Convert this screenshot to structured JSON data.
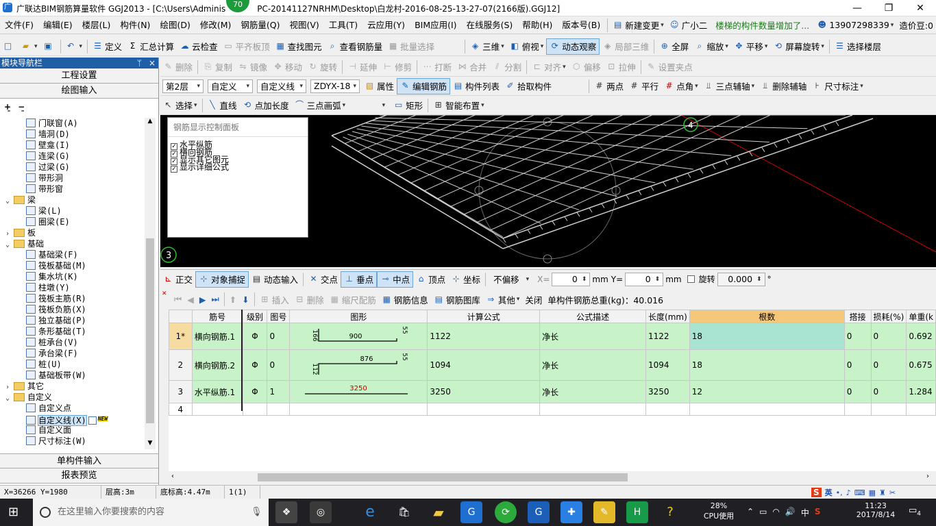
{
  "window": {
    "title": "广联达BIM钢筋算量软件 GGJ2013 - [C:\\Users\\Adminis",
    "title_rest": "PC-20141127NRHM\\Desktop\\白龙村-2016-08-25-13-27-07(2166版).GGJ12]",
    "badge": "70",
    "controls": {
      "minimize": "—",
      "restore": "❐",
      "close": "✕"
    }
  },
  "menu": [
    "文件(F)",
    "编辑(E)",
    "楼层(L)",
    "构件(N)",
    "绘图(D)",
    "修改(M)",
    "钢筋量(Q)",
    "视图(V)",
    "工具(T)",
    "云应用(Y)",
    "BIM应用(I)",
    "在线服务(S)",
    "帮助(H)",
    "版本号(B)"
  ],
  "menu_right": {
    "new_change": "新建变更",
    "assistant": "广小二",
    "notice": "楼梯的构件数量增加了...",
    "phone": "13907298339",
    "price": "造价豆:0"
  },
  "toolbar1": {
    "define": "定义",
    "sum_calc": "汇总计算",
    "cloud_check": "云检查",
    "flush_top": "平齐板顶",
    "find_elem": "查找图元",
    "view_rebar": "查看钢筋量",
    "batch_select": "批量选择",
    "view3d": "三维",
    "topview": "俯视",
    "dynamic_view": "动态观察",
    "local3d": "局部三维",
    "fullscreen": "全屏",
    "zoom": "缩放",
    "pan": "平移",
    "rotate_screen": "屏幕旋转",
    "select_floor": "选择楼层"
  },
  "toolbar2": [
    "删除",
    "复制",
    "镜像",
    "移动",
    "旋转",
    "延伸",
    "修剪",
    "打断",
    "合并",
    "分割",
    "对齐",
    "偏移",
    "拉伸",
    "设置夹点"
  ],
  "toolbar3": {
    "floor": "第2层",
    "category": "自定义",
    "type": "自定义线",
    "name": "ZDYX-18",
    "property": "属性",
    "edit_rebar": "编辑钢筋",
    "component_list": "构件列表",
    "pick_component": "拾取构件",
    "two_points": "两点",
    "parallel": "平行",
    "point_angle": "点角",
    "three_point_aux": "三点辅轴",
    "delete_aux": "删除辅轴",
    "dimension": "尺寸标注"
  },
  "toolbar4": {
    "select": "选择",
    "line": "直线",
    "point_length": "点加长度",
    "three_point_arc": "三点画弧",
    "rectangle": "矩形",
    "smart_layout": "智能布置"
  },
  "leftpanel": {
    "title": "模块导航栏",
    "pin": "ᛘ",
    "close": "×",
    "project_settings": "工程设置",
    "drawing_input": "绘图输入",
    "tree": [
      {
        "label": "门联窗(A)",
        "level": 2,
        "kind": "item"
      },
      {
        "label": "墙洞(D)",
        "level": 2,
        "kind": "item"
      },
      {
        "label": "壁龛(I)",
        "level": 2,
        "kind": "item"
      },
      {
        "label": "连梁(G)",
        "level": 2,
        "kind": "item"
      },
      {
        "label": "过梁(G)",
        "level": 2,
        "kind": "item"
      },
      {
        "label": "带形洞",
        "level": 2,
        "kind": "item"
      },
      {
        "label": "带形窗",
        "level": 2,
        "kind": "item"
      },
      {
        "label": "梁",
        "level": 1,
        "kind": "folder",
        "exp": "⌄"
      },
      {
        "label": "梁(L)",
        "level": 2,
        "kind": "item"
      },
      {
        "label": "圈梁(E)",
        "level": 2,
        "kind": "item"
      },
      {
        "label": "板",
        "level": 1,
        "kind": "folder",
        "exp": "›"
      },
      {
        "label": "基础",
        "level": 1,
        "kind": "folder",
        "exp": "⌄"
      },
      {
        "label": "基础梁(F)",
        "level": 2,
        "kind": "item"
      },
      {
        "label": "筏板基础(M)",
        "level": 2,
        "kind": "item"
      },
      {
        "label": "集水坑(K)",
        "level": 2,
        "kind": "item"
      },
      {
        "label": "柱墩(Y)",
        "level": 2,
        "kind": "item"
      },
      {
        "label": "筏板主筋(R)",
        "level": 2,
        "kind": "item"
      },
      {
        "label": "筏板负筋(X)",
        "level": 2,
        "kind": "item"
      },
      {
        "label": "独立基础(P)",
        "level": 2,
        "kind": "item"
      },
      {
        "label": "条形基础(T)",
        "level": 2,
        "kind": "item"
      },
      {
        "label": "桩承台(V)",
        "level": 2,
        "kind": "item"
      },
      {
        "label": "承台梁(F)",
        "level": 2,
        "kind": "item"
      },
      {
        "label": "桩(U)",
        "level": 2,
        "kind": "item"
      },
      {
        "label": "基础板带(W)",
        "level": 2,
        "kind": "item"
      },
      {
        "label": "其它",
        "level": 1,
        "kind": "folder",
        "exp": "›"
      },
      {
        "label": "自定义",
        "level": 1,
        "kind": "folder",
        "exp": "⌄"
      },
      {
        "label": "自定义点",
        "level": 2,
        "kind": "item"
      },
      {
        "label": "自定义线(X)",
        "level": 2,
        "kind": "item",
        "selected": true,
        "new": "NEW"
      },
      {
        "label": "自定义面",
        "level": 2,
        "kind": "item"
      },
      {
        "label": "尺寸标注(W)",
        "level": 2,
        "kind": "item"
      }
    ],
    "single_input": "单构件输入",
    "report_preview": "报表预览"
  },
  "rebar_panel": {
    "title": "钢筋显示控制面板",
    "items": [
      "水平纵筋",
      "横向钢筋",
      "显示其它图元",
      "显示详细公式"
    ]
  },
  "canvas_marks": {
    "axis_3": "3",
    "axis_4": "4"
  },
  "snapbar": {
    "ortho": "正交",
    "object_snap": "对象捕捉",
    "dynamic_input": "动态输入",
    "intersection": "交点",
    "perpendicular": "垂点",
    "midpoint": "中点",
    "vertex": "顶点",
    "coordinate": "坐标",
    "no_offset": "不偏移",
    "x_label": "X=",
    "x_value": "0",
    "y_label": "Y=",
    "y_value": "0",
    "unit": "mm",
    "rotate": "旋转",
    "rotate_value": "0.000",
    "degree": "°"
  },
  "table_toolbar": {
    "insert": "插入",
    "delete": "删除",
    "scale_fit": "缩尺配筋",
    "rebar_info": "钢筋信息",
    "rebar_lib": "钢筋图库",
    "other": "其他",
    "close": "关闭",
    "total_weight": "单构件钢筋总重(kg)：40.016"
  },
  "grid": {
    "headers": [
      "筋号",
      "级别",
      "图号",
      "图形",
      "计算公式",
      "公式描述",
      "长度(mm)",
      "根数",
      "搭接",
      "损耗(%)",
      "单重(k"
    ],
    "rows": [
      {
        "rn": "1*",
        "name": "横向钢筋.1",
        "grade": "Φ",
        "fig": "0",
        "shape": {
          "top": "900",
          "left": "166",
          "right": "55"
        },
        "formula": "1122",
        "desc": "净长",
        "length": "1122",
        "count": "18",
        "lap": "0",
        "loss": "0",
        "unit_weight": "0.692"
      },
      {
        "rn": "2",
        "name": "横向钢筋.2",
        "grade": "Φ",
        "fig": "0",
        "shape": {
          "top": "876",
          "left": "112",
          "right": "55"
        },
        "formula": "1094",
        "desc": "净长",
        "length": "1094",
        "count": "18",
        "lap": "0",
        "loss": "0",
        "unit_weight": "0.675"
      },
      {
        "rn": "3",
        "name": "水平纵筋.1",
        "grade": "Φ",
        "fig": "1",
        "shape": {
          "top": "3250"
        },
        "formula": "3250",
        "desc": "净长",
        "length": "3250",
        "count": "12",
        "lap": "0",
        "loss": "0",
        "unit_weight": "1.284"
      },
      {
        "rn": "4"
      }
    ]
  },
  "status": {
    "coords": "X=36266 Y=1980",
    "floor_height": "层高:3m",
    "bottom_elev": "底标高:4.47m",
    "selection": "1(1)"
  },
  "taskbar": {
    "search_placeholder": "在这里输入你要搜索的内容",
    "cpu_percent": "28%",
    "cpu_label": "CPU使用",
    "ime": "中",
    "time": "11:23",
    "date": "2017/8/14",
    "notifications": "4",
    "tray_ime": "英"
  }
}
